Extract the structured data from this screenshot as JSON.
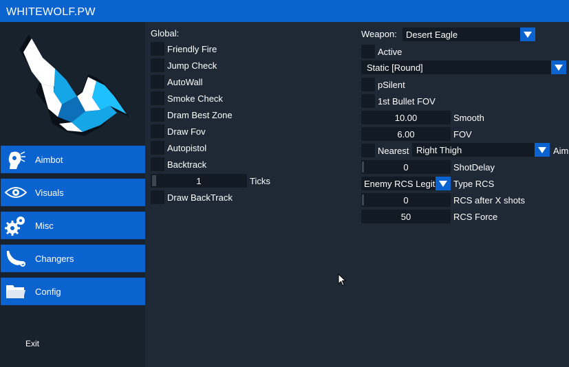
{
  "window": {
    "title": "WHITEWOLF.PW"
  },
  "sidebar": {
    "items": [
      {
        "label": "Aimbot",
        "icon": "aimbot-head-icon"
      },
      {
        "label": "Visuals",
        "icon": "eye-icon"
      },
      {
        "label": "Misc",
        "icon": "gears-icon"
      },
      {
        "label": "Changers",
        "icon": "knife-icon"
      },
      {
        "label": "Config",
        "icon": "folder-icon"
      }
    ],
    "exit_label": "Exit"
  },
  "global": {
    "heading": "Global:",
    "options": [
      {
        "label": "Friendly Fire"
      },
      {
        "label": "Jump Check"
      },
      {
        "label": "AutoWall"
      },
      {
        "label": "Smoke Check"
      },
      {
        "label": "Dram Best Zone"
      },
      {
        "label": "Draw Fov"
      },
      {
        "label": "Autopistol"
      },
      {
        "label": "Backtrack"
      }
    ],
    "ticks": {
      "value": "1",
      "label": "Ticks"
    },
    "draw_backtrack": {
      "label": "Draw BackTrack"
    }
  },
  "weapon": {
    "label": "Weapon:",
    "selected": "Desert Eagle",
    "active_label": "Active",
    "mode": "Static [Round]",
    "psilent_label": "pSilent",
    "first_bullet_label": "1st Bullet FOV",
    "smooth": {
      "value": "10.00",
      "label": "Smooth"
    },
    "fov": {
      "value": "6.00",
      "label": "FOV"
    },
    "nearest_label": "Nearest",
    "hitbox": "Right Thigh",
    "hitbox_trailing": "Aim",
    "shot_delay": {
      "value": "0",
      "label": "ShotDelay"
    },
    "rcs_type": {
      "selected": "Enemy RCS Legit",
      "label": "Type RCS"
    },
    "rcs_after": {
      "value": "0",
      "label": "RCS after X shots"
    },
    "rcs_force": {
      "value": "50",
      "label": "RCS Force"
    }
  },
  "colors": {
    "accent": "#0a63cf",
    "panel": "#1e2935",
    "sidebar": "#18222d",
    "control": "#121a23"
  }
}
